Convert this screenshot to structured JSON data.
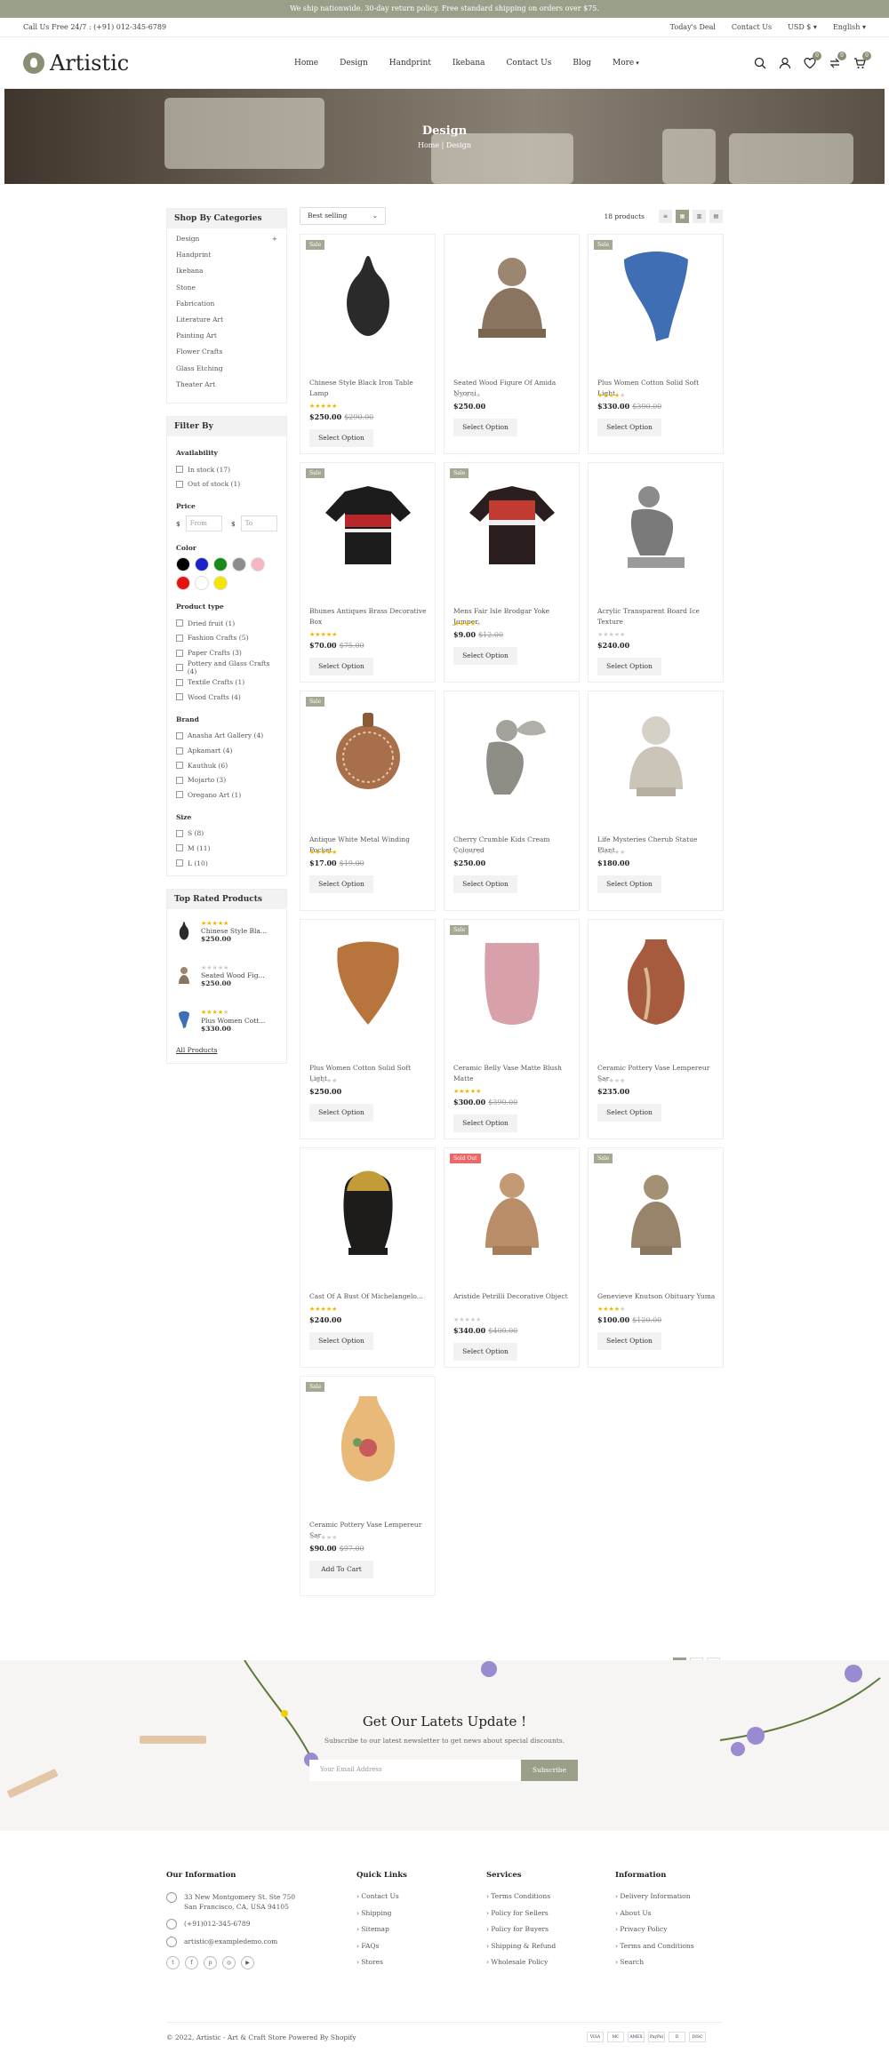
{
  "topbar": {
    "announcement": "We ship nationwide. 30-day return policy. Free standard shipping on orders over $75."
  },
  "util": {
    "call": "Call Us Free 24/7 : (+91) 012-345-6789",
    "deal": "Today's Deal",
    "contact": "Contact Us",
    "currency": "USD $",
    "language": "English"
  },
  "brand": {
    "name": "Artistic"
  },
  "nav": {
    "items": [
      "Home",
      "Design",
      "Handprint",
      "Ikebana",
      "Contact Us",
      "Blog",
      "More"
    ]
  },
  "header_icons": {
    "wishlist_count": "0",
    "compare_count": "0",
    "cart_count": "0"
  },
  "hero": {
    "title": "Design",
    "crumb_home": "Home",
    "crumb_sep": "|",
    "crumb_current": "Design"
  },
  "categories": {
    "title": "Shop By Categories",
    "items": [
      "Design",
      "Handprint",
      "Ikebana",
      "Stone",
      "Fabrication",
      "Literature Art",
      "Painting Art",
      "Flower Crafts",
      "Glass Etching",
      "Theater Art"
    ],
    "expand": "+"
  },
  "filter": {
    "title": "Filter By",
    "availability_title": "Availability",
    "availability": [
      "In stock (17)",
      "Out of stock (1)"
    ],
    "price_title": "Price",
    "currency_sign": "$",
    "from_placeholder": "From",
    "to_placeholder": "To",
    "color_title": "Color",
    "colors": [
      "#000000",
      "#1b22c9",
      "#1a8a1a",
      "#8c8c8c",
      "#f6b7c2",
      "#e8120f",
      "#ffffff",
      "#f5e600"
    ],
    "type_title": "Product type",
    "types": [
      "Dried fruit (1)",
      "Fashion Crafts (5)",
      "Paper Crafts (3)",
      "Pottery and Glass Crafts (4)",
      "Textile Crafts (1)",
      "Wood Crafts (4)"
    ],
    "brand_title": "Brand",
    "brands": [
      "Anasha Art Gallery (4)",
      "Apkamart (4)",
      "Kauthuk (6)",
      "Mojarto (3)",
      "Oregano Art (1)"
    ],
    "size_title": "Size",
    "sizes": [
      "S (8)",
      "M (11)",
      "L (10)"
    ]
  },
  "top_rated": {
    "title": "Top Rated Products",
    "items": [
      {
        "name": "Chinese Style Bla...",
        "price": "$250.00",
        "stars": "★★★★★",
        "muted": ""
      },
      {
        "name": "Seated Wood Fig...",
        "price": "$250.00",
        "stars": "",
        "muted": "★★★★★"
      },
      {
        "name": "Plus Women Cott...",
        "price": "$330.00",
        "stars": "★★★★",
        "muted": "★"
      }
    ],
    "all_link": "All Products"
  },
  "toolbar": {
    "sort": "Best selling",
    "count": "18 products"
  },
  "products": [
    {
      "name": "Chinese Style Black Iron Table Lamp",
      "price": "$250.00",
      "old": "$290.00",
      "badge": "Sale",
      "stars": "★★★★★",
      "muted": "",
      "button": "Select Option",
      "icon": "black-vase-icon"
    },
    {
      "name": "Seated Wood Figure Of Amida Nyorai",
      "price": "$250.00",
      "old": "",
      "badge": "",
      "stars": "",
      "muted": "★★★★★",
      "button": "Select Option",
      "icon": "buddha-statue-icon"
    },
    {
      "name": "Plus Women Cotton Solid Soft Light",
      "price": "$330.00",
      "old": "$390.00",
      "badge": "Sale",
      "stars": "★★★★",
      "muted": "★",
      "button": "Select Option",
      "icon": "blue-scarf-icon"
    },
    {
      "name": "Bhunes Antiques Brass Decorative Box",
      "price": "$70.00",
      "old": "$75.00",
      "badge": "Sale",
      "stars": "★★★★★",
      "muted": "",
      "button": "Select Option",
      "icon": "sweater-icon"
    },
    {
      "name": "Mens Fair Isle Brodgar Yoke Jumper",
      "price": "$9.00",
      "old": "$12.00",
      "badge": "Sale",
      "stars": "★★★★",
      "muted": "★",
      "button": "Select Option",
      "icon": "jumper-icon"
    },
    {
      "name": "Acrylic Transparent Board Ice Texture",
      "price": "$240.00",
      "old": "",
      "badge": "",
      "stars": "",
      "muted": "★★★★★",
      "button": "Select Option",
      "icon": "thinker-statue-icon"
    },
    {
      "name": "Antique White Metal Winding Pocket",
      "price": "$17.00",
      "old": "$19.00",
      "badge": "Sale",
      "stars": "★★★★★",
      "muted": "",
      "button": "Select Option",
      "icon": "pocket-watch-icon"
    },
    {
      "name": "Cherry Crumble Kids Cream Coloured",
      "price": "$250.00",
      "old": "",
      "badge": "",
      "stars": "",
      "muted": "★★★★★",
      "button": "Select Option",
      "icon": "cherub-statue-icon"
    },
    {
      "name": "Life Mysteries Cherub Statue Plant",
      "price": "$180.00",
      "old": "",
      "badge": "",
      "stars": "",
      "muted": "★★★★★",
      "button": "Select Option",
      "icon": "bust-statue-icon"
    },
    {
      "name": "Plus Women Cotton Solid Soft Light",
      "price": "$250.00",
      "old": "",
      "badge": "",
      "stars": "",
      "muted": "★★★★★",
      "button": "Select Option",
      "icon": "brown-scarf-icon"
    },
    {
      "name": "Ceramic Belly Vase Matte Blush Matte",
      "price": "$300.00",
      "old": "$390.00",
      "badge": "Sale",
      "stars": "★★★★★",
      "muted": "",
      "button": "Select Option",
      "icon": "pink-vase-icon"
    },
    {
      "name": "Ceramic Pottery Vase Lempereur Sar",
      "price": "$235.00",
      "old": "",
      "badge": "",
      "stars": "",
      "muted": "★★★★★",
      "button": "Select Option",
      "icon": "red-vase-icon"
    },
    {
      "name": "Cast Of A Bust Of Michelangelo...",
      "price": "$240.00",
      "old": "",
      "badge": "",
      "stars": "★★★★★",
      "muted": "",
      "button": "Select Option",
      "icon": "buddha-head-icon"
    },
    {
      "name": "Aristide Petrilli Decorative Object",
      "price": "$340.00",
      "old": "$400.00",
      "badge": "Sold Out",
      "stars": "",
      "muted": "★★★★★",
      "button": "Select Option",
      "icon": "woman-bust-icon"
    },
    {
      "name": "Genevieve Knutson Obituary Yuma",
      "price": "$100.00",
      "old": "$120.00",
      "badge": "Sale",
      "stars": "★★★★",
      "muted": "★",
      "button": "Select Option",
      "icon": "female-bust-icon"
    },
    {
      "name": "Ceramic Pottery Vase Lempereur Sar",
      "price": "$90.00",
      "old": "$97.00",
      "badge": "Sale",
      "stars": "",
      "muted": "★★★★★",
      "button": "Add To Cart",
      "icon": "floral-vase-icon"
    }
  ],
  "pagination": {
    "pages": [
      "1",
      "2"
    ],
    "next": "›"
  },
  "newsletter": {
    "title": "Get Our Latets Update !",
    "text": "Subscribe to our latest newsletter to get news about special discounts.",
    "placeholder": "Your Email Address",
    "button": "Subscribe"
  },
  "footer": {
    "info_title": "Our Information",
    "address": "33 New Montgomery St. Ste 750 San Francisco, CA, USA 94105",
    "phone": "(+91)012-345-6789",
    "email": "artistic@exampledemo.com",
    "quick_title": "Quick Links",
    "quick": [
      "Contact Us",
      "Shipping",
      "Sitemap",
      "FAQs",
      "Stores"
    ],
    "services_title": "Services",
    "services": [
      "Terms Conditions",
      "Policy for Sellers",
      "Policy for Buyers",
      "Shipping & Refund",
      "Wholesale Policy"
    ],
    "information_title": "Information",
    "information": [
      "Delivery Information",
      "About Us",
      "Privacy Policy",
      "Terms and Conditions",
      "Search"
    ],
    "copyright": "© 2022, Artistic - Art & Craft Store Powered By Shopify",
    "payments": [
      "VISA",
      "MC",
      "AMEX",
      "PayPal",
      "D",
      "DISC"
    ]
  }
}
